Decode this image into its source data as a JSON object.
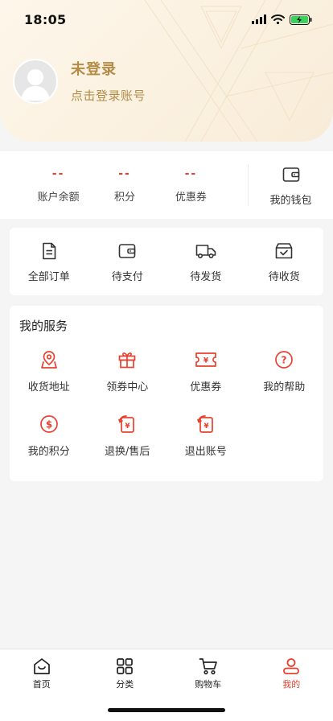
{
  "status_bar": {
    "time": "18:05"
  },
  "profile": {
    "name": "未登录",
    "subtitle": "点击登录账号"
  },
  "stats": [
    {
      "value": "--",
      "label": "账户余额"
    },
    {
      "value": "--",
      "label": "积分"
    },
    {
      "value": "--",
      "label": "优惠券"
    }
  ],
  "wallet": {
    "label": "我的钱包",
    "icon": "wallet-icon"
  },
  "orders": [
    {
      "label": "全部订单",
      "icon": "document-icon"
    },
    {
      "label": "待支付",
      "icon": "wallet-icon"
    },
    {
      "label": "待发货",
      "icon": "truck-icon"
    },
    {
      "label": "待收货",
      "icon": "box-check-icon"
    }
  ],
  "services": {
    "title": "我的服务",
    "items": [
      {
        "label": "收货地址",
        "icon": "location-icon"
      },
      {
        "label": "领券中心",
        "icon": "gift-icon"
      },
      {
        "label": "优惠券",
        "icon": "coupon-icon"
      },
      {
        "label": "我的帮助",
        "icon": "help-icon"
      },
      {
        "label": "我的积分",
        "icon": "dollar-icon"
      },
      {
        "label": "退换/售后",
        "icon": "refund-icon"
      },
      {
        "label": "退出账号",
        "icon": "refund-icon"
      }
    ]
  },
  "tabbar": [
    {
      "label": "首页",
      "icon": "home-icon",
      "active": false
    },
    {
      "label": "分类",
      "icon": "grid-icon",
      "active": false
    },
    {
      "label": "购物车",
      "icon": "cart-icon",
      "active": false
    },
    {
      "label": "我的",
      "icon": "user-icon",
      "active": true
    }
  ],
  "colors": {
    "accent": "#e8402f",
    "gold": "#b38c45",
    "header_bg": "#fbf1e0"
  }
}
